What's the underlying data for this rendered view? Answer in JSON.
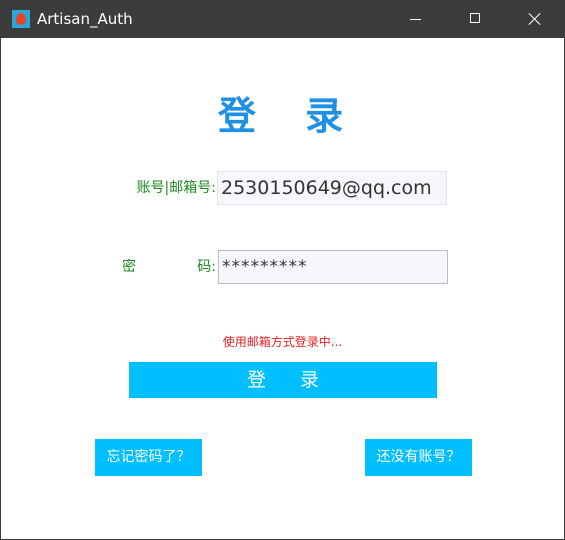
{
  "window": {
    "title": "Artisan_Auth",
    "icon": "app-flame-icon",
    "controls": {
      "minimize": "minimize-icon",
      "maximize": "maximize-icon",
      "close": "close-icon"
    }
  },
  "login": {
    "heading": "登 录",
    "account_label": "账号|邮箱号:",
    "account_value": "2530150649@qq.com",
    "password_label_left": "密",
    "password_label_right": "码:",
    "password_value": "*********",
    "status_text": "使用邮箱方式登录中...",
    "login_button": "登 录",
    "forgot_button": "忘记密码了？",
    "register_button": "还没有账号？"
  },
  "colors": {
    "titlebar": "#3c3c3c",
    "heading": "#1e90e6",
    "label": "#1a8a1a",
    "status": "#e82020",
    "button": "#00bfff"
  }
}
